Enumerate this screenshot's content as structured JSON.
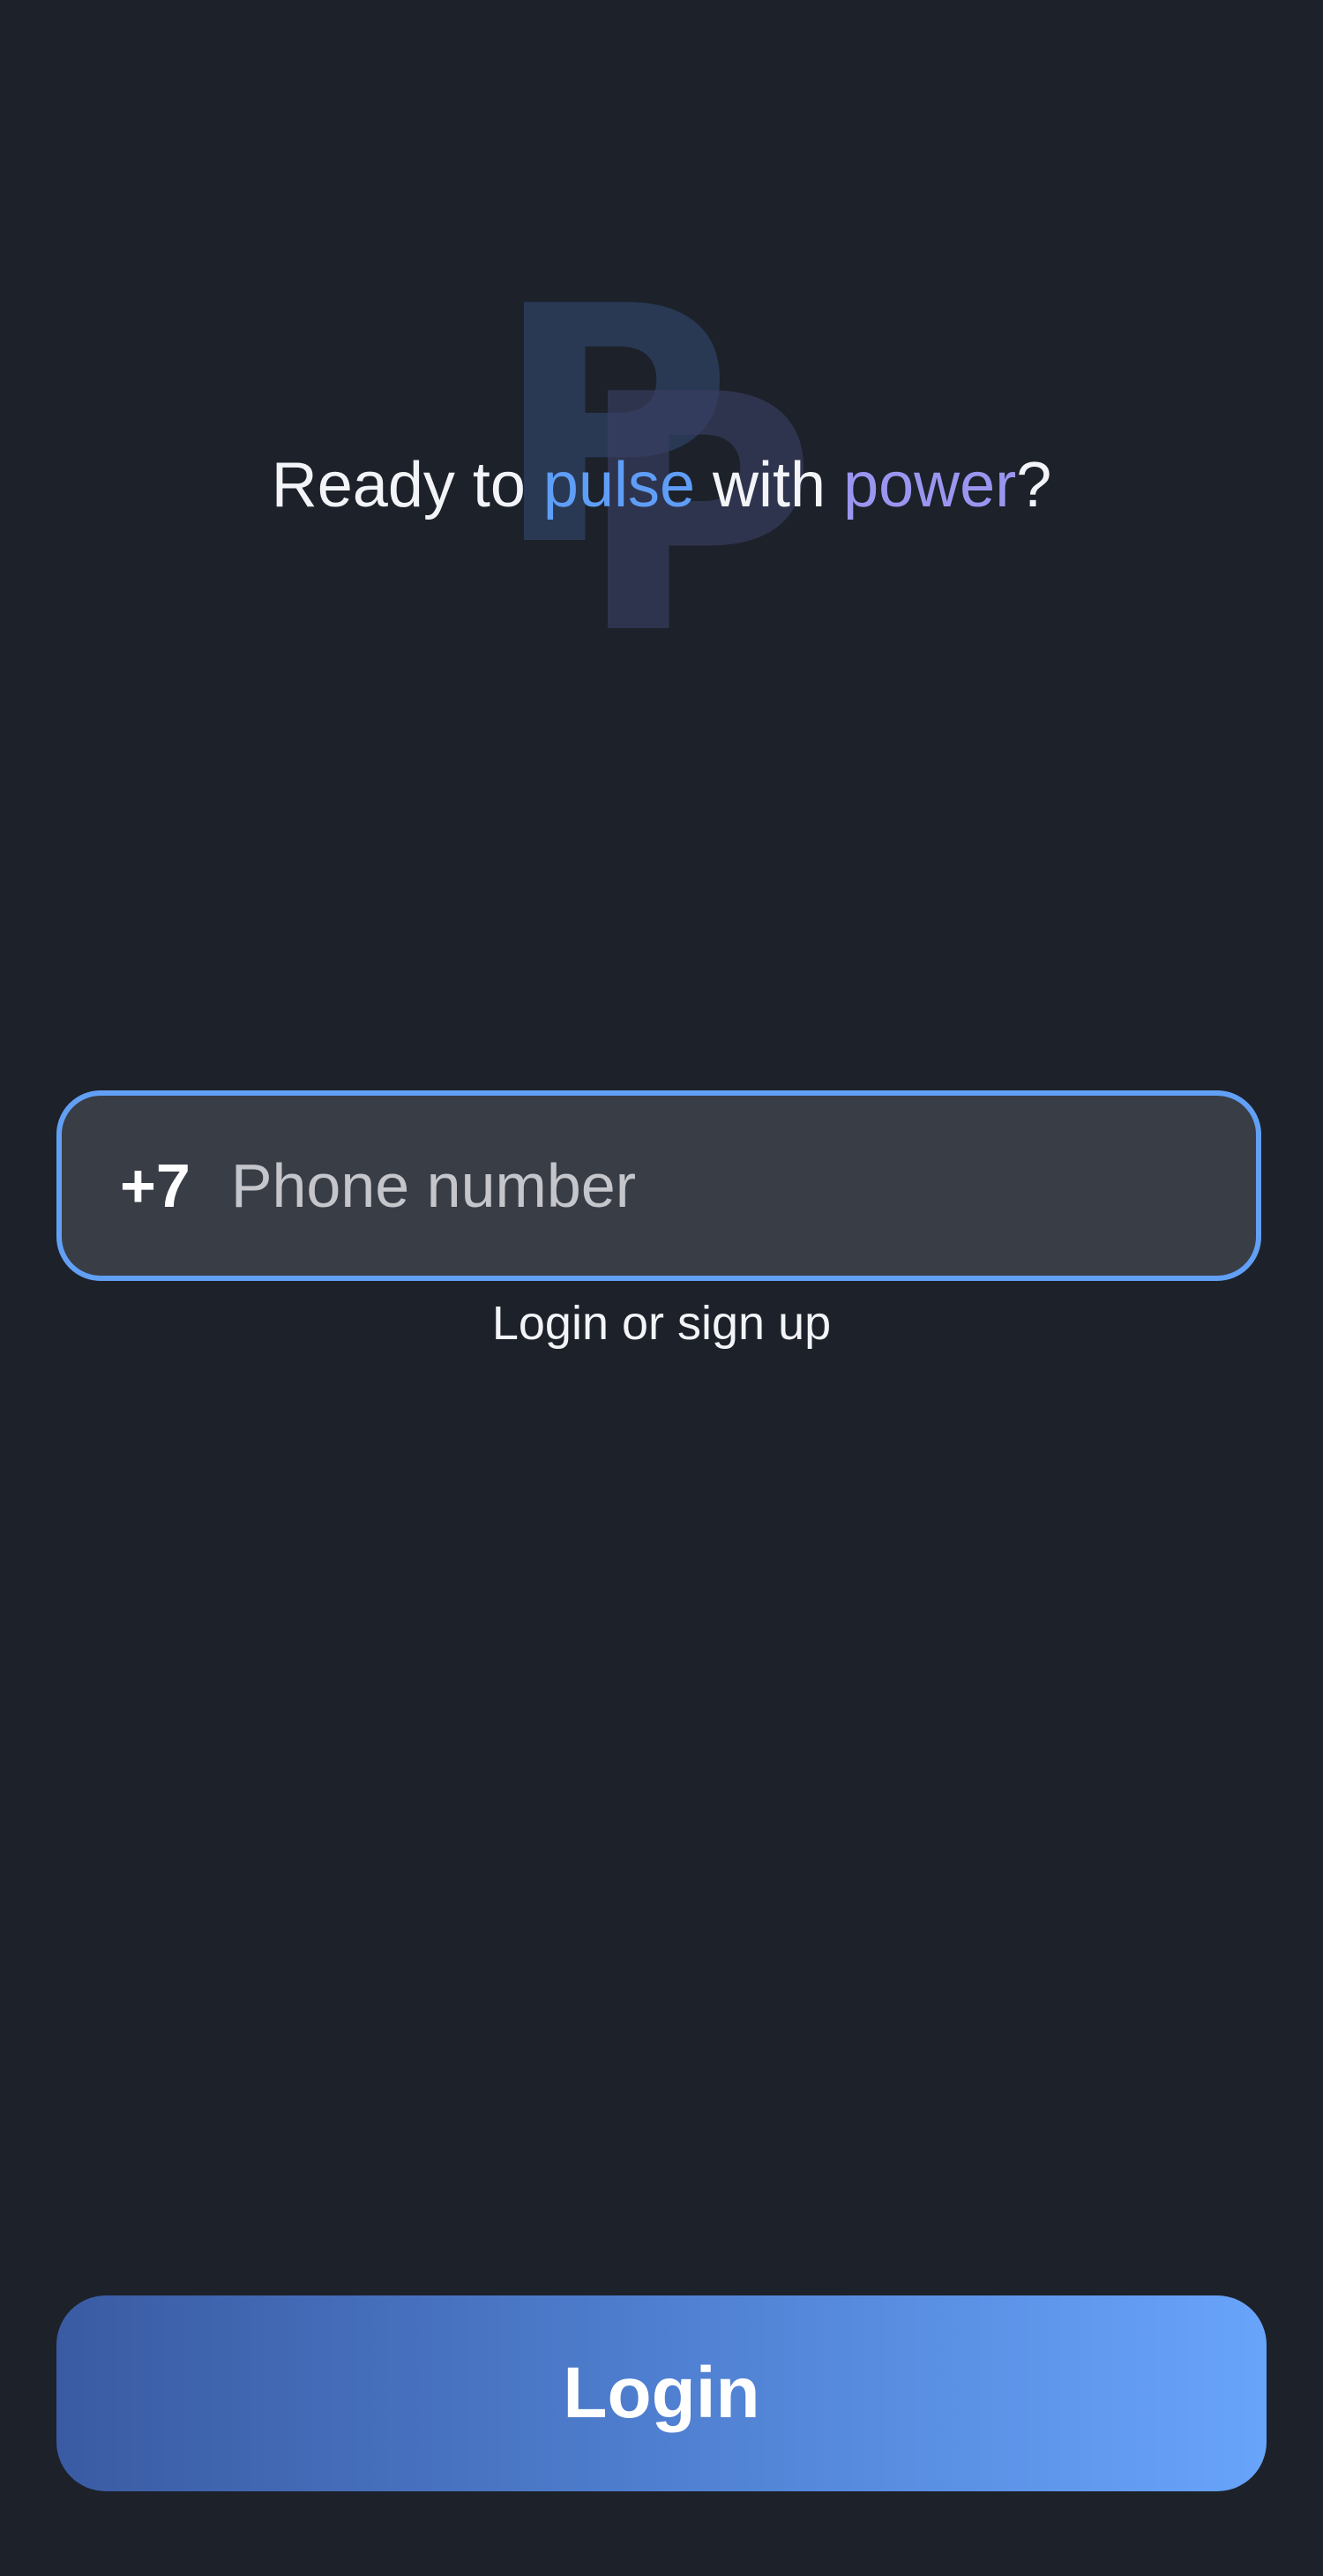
{
  "logo": {
    "letters": [
      "P",
      "P"
    ],
    "icon": "pp-logo-watermark"
  },
  "headline": {
    "part1": "Ready to ",
    "accent1": "pulse",
    "part2": " with ",
    "accent2": "power",
    "part3": "?"
  },
  "phone": {
    "country_code": "+7",
    "placeholder": "Phone number",
    "value": ""
  },
  "hint": "Login or sign up",
  "login_button": "Login",
  "colors": {
    "background": "#1d2129",
    "accent_blue": "#5f9ef7",
    "accent_purple": "#9a96f0",
    "input_border": "#62a0f6",
    "input_background": "#393d46",
    "button_gradient_start": "#3a5ba3",
    "button_gradient_end": "#68a4fb"
  }
}
